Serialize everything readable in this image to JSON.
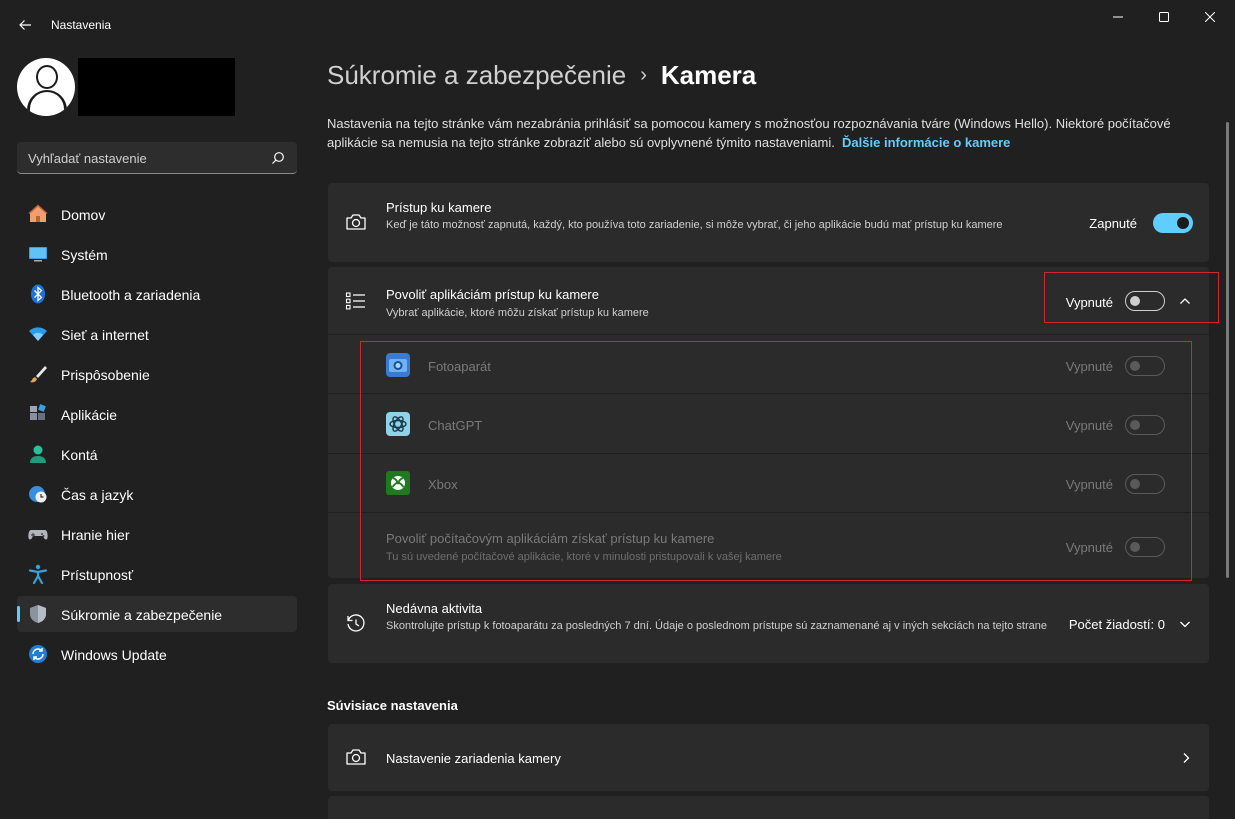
{
  "window": {
    "title": "Nastavenia"
  },
  "search": {
    "placeholder": "Vyhľadať nastavenie"
  },
  "sidebar": {
    "items": [
      {
        "label": "Domov",
        "icon": "home-icon"
      },
      {
        "label": "Systém",
        "icon": "system-icon"
      },
      {
        "label": "Bluetooth a zariadenia",
        "icon": "bluetooth-icon"
      },
      {
        "label": "Sieť a internet",
        "icon": "wifi-icon"
      },
      {
        "label": "Prispôsobenie",
        "icon": "brush-icon"
      },
      {
        "label": "Aplikácie",
        "icon": "apps-icon"
      },
      {
        "label": "Kontá",
        "icon": "account-icon"
      },
      {
        "label": "Čas a jazyk",
        "icon": "clock-globe-icon"
      },
      {
        "label": "Hranie hier",
        "icon": "gamepad-icon"
      },
      {
        "label": "Prístupnosť",
        "icon": "accessibility-icon"
      },
      {
        "label": "Súkromie a zabezpečenie",
        "icon": "shield-icon",
        "active": true
      },
      {
        "label": "Windows Update",
        "icon": "update-icon"
      }
    ]
  },
  "breadcrumb": {
    "parent": "Súkromie a zabezpečenie",
    "separator": "›",
    "current": "Kamera"
  },
  "intro": {
    "text": "Nastavenia na tejto stránke vám nezabránia prihlásiť sa pomocou kamery s možnosťou rozpoznávania tváre (Windows Hello). Niektoré počítačové aplikácie sa nemusia na tejto stránke zobraziť alebo sú ovplyvnené týmito nastaveniami.",
    "link": "Ďalšie informácie o kamere"
  },
  "camera_access": {
    "title": "Prístup ku kamere",
    "description": "Keď je táto možnosť zapnutá, každý, kto používa toto zariadenie, si môže vybrať, či jeho aplikácie budú mať prístup ku kamere",
    "state": "Zapnuté",
    "on": true
  },
  "app_access": {
    "title": "Povoliť aplikáciám prístup ku kamere",
    "description": "Vybrať aplikácie, ktoré môžu získať prístup ku kamere",
    "state": "Vypnuté",
    "on": false,
    "expanded": true,
    "apps": [
      {
        "name": "Fotoaparát",
        "icon": "camera-app-icon",
        "state": "Vypnuté"
      },
      {
        "name": "ChatGPT",
        "icon": "chatgpt-icon",
        "state": "Vypnuté"
      },
      {
        "name": "Xbox",
        "icon": "xbox-icon",
        "state": "Vypnuté"
      }
    ],
    "desktop_apps": {
      "title": "Povoliť počítačovým aplikáciám získať prístup ku kamere",
      "description": "Tu sú uvedené počítačové aplikácie, ktoré v minulosti pristupovali k vašej kamere",
      "state": "Vypnuté"
    }
  },
  "recent_activity": {
    "title": "Nedávna aktivita",
    "description": "Skontrolujte prístup k fotoaparátu za posledných 7 dní. Údaje o poslednom prístupe sú zaznamenané aj v iných sekciách na tejto strane",
    "count_label": "Počet žiadostí: 0"
  },
  "related": {
    "heading": "Súvisiace nastavenia",
    "camera_settings": "Nastavenie zariadenia kamery"
  },
  "colors": {
    "accent": "#60cdff",
    "highlight_box": "#d1262b",
    "background": "#202020",
    "card": "#2b2b2b"
  }
}
